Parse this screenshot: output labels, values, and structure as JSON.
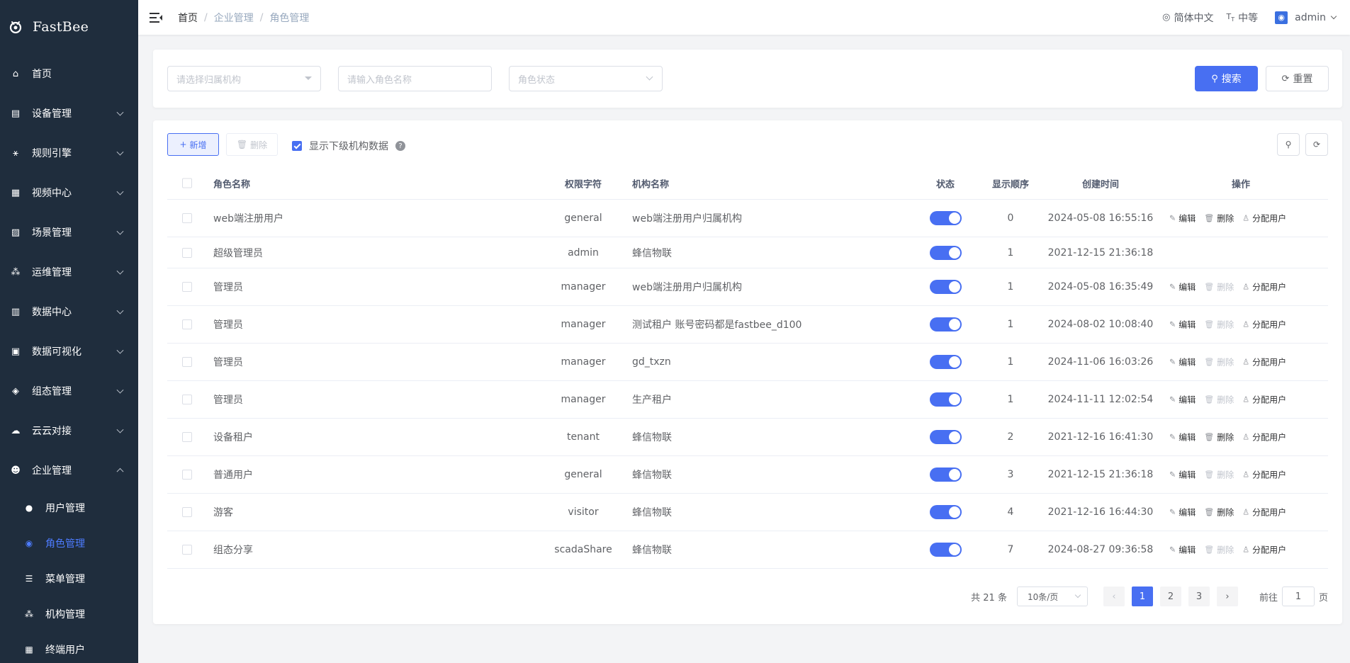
{
  "app": {
    "name": "FastBee"
  },
  "sidebar": {
    "items": [
      {
        "label": "首页",
        "icon": "home-icon",
        "glyph": "⌂",
        "expandable": false
      },
      {
        "label": "设备管理",
        "icon": "device-icon",
        "glyph": "▤",
        "expandable": true
      },
      {
        "label": "规则引擎",
        "icon": "rule-icon",
        "glyph": "⚹",
        "expandable": true
      },
      {
        "label": "视频中心",
        "icon": "video-icon",
        "glyph": "▦",
        "expandable": true
      },
      {
        "label": "场景管理",
        "icon": "scene-icon",
        "glyph": "▨",
        "expandable": true
      },
      {
        "label": "运维管理",
        "icon": "ops-icon",
        "glyph": "⁂",
        "expandable": true
      },
      {
        "label": "数据中心",
        "icon": "data-icon",
        "glyph": "▥",
        "expandable": true
      },
      {
        "label": "数据可视化",
        "icon": "visual-icon",
        "glyph": "▣",
        "expandable": true
      },
      {
        "label": "组态管理",
        "icon": "layers-icon",
        "glyph": "◈",
        "expandable": true
      },
      {
        "label": "云云对接",
        "icon": "cloud-icon",
        "glyph": "☁",
        "expandable": true
      },
      {
        "label": "企业管理",
        "icon": "enterprise-icon",
        "glyph": "☻",
        "expandable": true,
        "expanded": true
      }
    ],
    "subitems": [
      {
        "label": "用户管理",
        "icon": "user-icon",
        "glyph": "●"
      },
      {
        "label": "角色管理",
        "icon": "role-icon",
        "glyph": "◉",
        "active": true
      },
      {
        "label": "菜单管理",
        "icon": "menu-tree-icon",
        "glyph": "☰"
      },
      {
        "label": "机构管理",
        "icon": "org-icon",
        "glyph": "⁂"
      },
      {
        "label": "终端用户",
        "icon": "terminal-user-icon",
        "glyph": "▦"
      }
    ]
  },
  "navbar": {
    "breadcrumb": [
      "首页",
      "企业管理",
      "角色管理"
    ],
    "lang": "简体中文",
    "size": "中等",
    "user": "admin"
  },
  "search": {
    "org_placeholder": "请选择归属机构",
    "name_placeholder": "请输入角色名称",
    "status_placeholder": "角色状态",
    "search_label": "搜索",
    "reset_label": "重置"
  },
  "toolbar": {
    "add_label": "新增",
    "delete_label": "删除",
    "show_sub_label": "显示下级机构数据",
    "show_sub_checked": true
  },
  "table": {
    "headers": {
      "name": "角色名称",
      "key": "权限字符",
      "org": "机构名称",
      "status": "状态",
      "order": "显示顺序",
      "time": "创建时间",
      "ops": "操作"
    },
    "op_labels": {
      "edit": "编辑",
      "delete": "删除",
      "assign": "分配用户"
    },
    "rows": [
      {
        "name": "web端注册用户",
        "key": "general",
        "org": "web端注册用户归属机构",
        "status": true,
        "order": "0",
        "time": "2024-05-08 16:55:16",
        "delete_enabled": true,
        "show_ops": true
      },
      {
        "name": "超级管理员",
        "key": "admin",
        "org": "蜂信物联",
        "status": true,
        "order": "1",
        "time": "2021-12-15 21:36:18",
        "delete_enabled": false,
        "show_ops": false
      },
      {
        "name": "管理员",
        "key": "manager",
        "org": "web端注册用户归属机构",
        "status": true,
        "order": "1",
        "time": "2024-05-08 16:35:49",
        "delete_enabled": false,
        "show_ops": true
      },
      {
        "name": "管理员",
        "key": "manager",
        "org": "测试租户 账号密码都是fastbee_d100",
        "status": true,
        "order": "1",
        "time": "2024-08-02 10:08:40",
        "delete_enabled": false,
        "show_ops": true
      },
      {
        "name": "管理员",
        "key": "manager",
        "org": "gd_txzn",
        "status": true,
        "order": "1",
        "time": "2024-11-06 16:03:26",
        "delete_enabled": false,
        "show_ops": true
      },
      {
        "name": "管理员",
        "key": "manager",
        "org": "生产租户",
        "status": true,
        "order": "1",
        "time": "2024-11-11 12:02:54",
        "delete_enabled": false,
        "show_ops": true
      },
      {
        "name": "设备租户",
        "key": "tenant",
        "org": "蜂信物联",
        "status": true,
        "order": "2",
        "time": "2021-12-16 16:41:30",
        "delete_enabled": true,
        "show_ops": true
      },
      {
        "name": "普通用户",
        "key": "general",
        "org": "蜂信物联",
        "status": true,
        "order": "3",
        "time": "2021-12-15 21:36:18",
        "delete_enabled": false,
        "show_ops": true
      },
      {
        "name": "游客",
        "key": "visitor",
        "org": "蜂信物联",
        "status": true,
        "order": "4",
        "time": "2021-12-16 16:44:30",
        "delete_enabled": true,
        "show_ops": true
      },
      {
        "name": "组态分享",
        "key": "scadaShare",
        "org": "蜂信物联",
        "status": true,
        "order": "7",
        "time": "2024-08-27 09:36:58",
        "delete_enabled": false,
        "show_ops": true
      }
    ]
  },
  "pagination": {
    "total_label": "共 21 条",
    "page_size": "10条/页",
    "pages": [
      "1",
      "2",
      "3"
    ],
    "current": "1",
    "goto_prefix": "前往",
    "goto_value": "1",
    "goto_suffix": "页"
  },
  "colors": {
    "primary": "#486ff2",
    "sidebar_bg": "#1f2d3d",
    "active_menu": "#4d7cff"
  }
}
